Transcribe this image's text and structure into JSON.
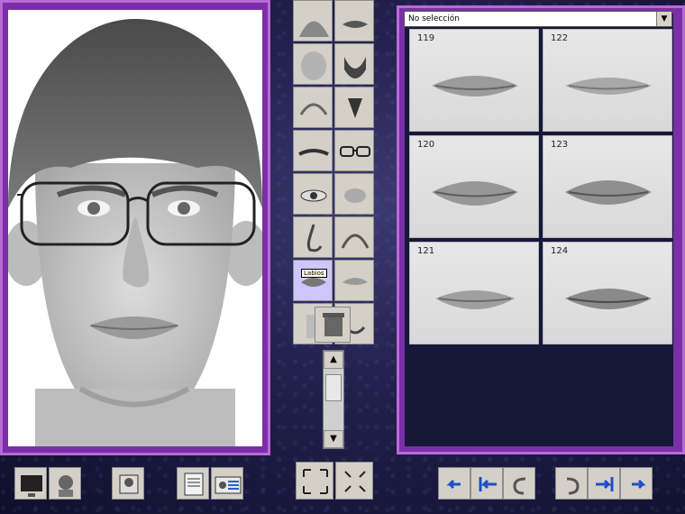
{
  "library": {
    "dropdown_value": "No selección",
    "items": [
      {
        "id": "119"
      },
      {
        "id": "122"
      },
      {
        "id": "120"
      },
      {
        "id": "123"
      },
      {
        "id": "121"
      },
      {
        "id": "124"
      }
    ]
  },
  "tooltip_text": "Labios",
  "colors": {
    "panel": "#7a2fa8",
    "panel_border": "#b86ad6",
    "button_face": "#d4d0c8",
    "selected_button": "#d0c6ff"
  }
}
